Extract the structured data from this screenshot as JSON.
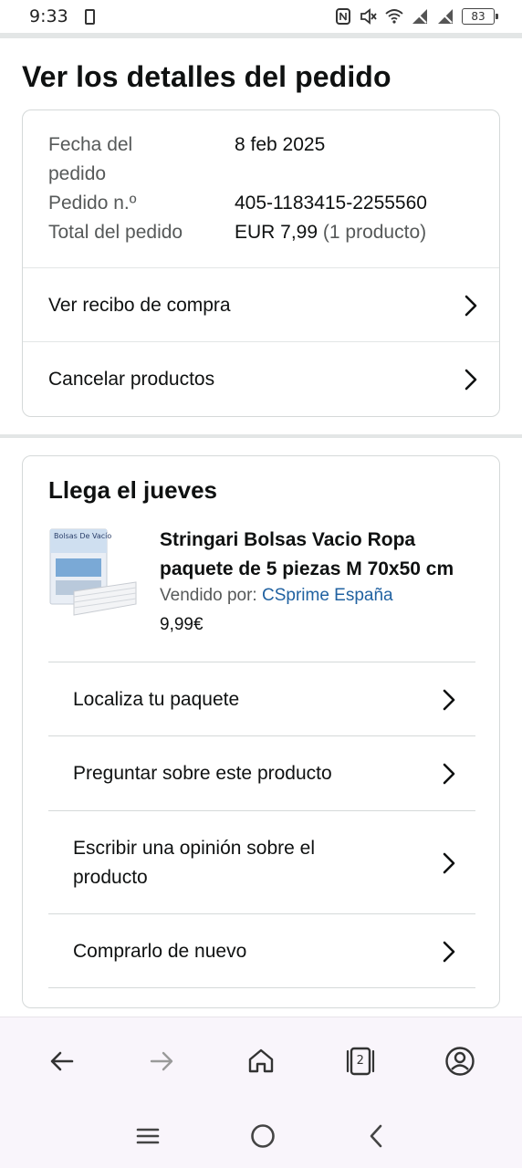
{
  "status_bar": {
    "time": "9:33",
    "battery": "83",
    "icons": [
      "sim-icon",
      "nfc-icon",
      "mute-icon",
      "wifi-icon",
      "no-signal-icon",
      "no-signal-icon",
      "battery-icon"
    ]
  },
  "page_title": "Ver los detalles del pedido",
  "order_summary": {
    "date_label": "Fecha del pedido",
    "date_value": "8 feb 2025",
    "order_label": "Pedido n.º",
    "order_value": "405-1183415-2255560",
    "total_label": "Total del pedido",
    "total_value": "EUR 7,99",
    "total_count": "(1 producto)"
  },
  "order_links": [
    {
      "label": "Ver recibo de compra"
    },
    {
      "label": "Cancelar productos"
    }
  ],
  "delivery": {
    "title": "Llega el jueves",
    "product_title_line1": "Stringari Bolsas Vacio Ropa",
    "product_title_line2": "paquete de 5 piezas M 70x50 cm",
    "product_image_text": "Bolsas De Vacío",
    "sold_by_label": "Vendido por:",
    "seller": "CSprime España",
    "price": "9,99€"
  },
  "actions": [
    {
      "label": "Localiza tu paquete"
    },
    {
      "label": "Preguntar sobre este producto"
    },
    {
      "label": "Escribir una opinión sobre el producto"
    },
    {
      "label": "Comprarlo de nuevo"
    }
  ],
  "browser_nav": {
    "tab_count": "2",
    "icons": [
      "back-arrow-icon",
      "forward-arrow-icon",
      "home-icon",
      "tabs-icon",
      "account-icon"
    ]
  },
  "colors": {
    "text": "#0f1111",
    "muted": "#565959",
    "link": "#2162a1",
    "border": "#d5d9d9",
    "nav_bg": "#f9f5fb"
  }
}
